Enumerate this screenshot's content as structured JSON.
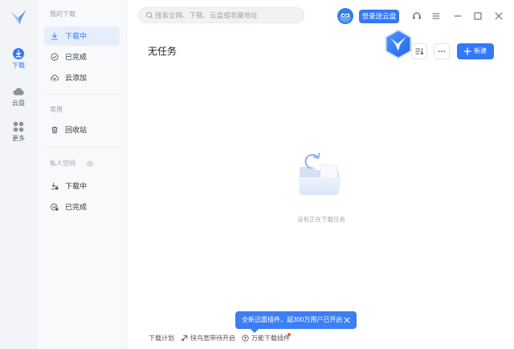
{
  "colors": {
    "primary": "#3478f6",
    "active_bg": "#e6eefd",
    "tooltip": "#3b7ef5",
    "badge": "#f25a45"
  },
  "rail": {
    "logo_icon": "thunder-bird-logo-icon",
    "items": [
      {
        "label": "下载",
        "icon": "download-circle-icon",
        "active": true
      },
      {
        "label": "云盘",
        "icon": "cloud-icon",
        "active": false
      },
      {
        "label": "更多",
        "icon": "grid-icon",
        "active": false
      }
    ]
  },
  "nav": {
    "sections": [
      {
        "title": "我的下载",
        "items": [
          {
            "label": "下载中",
            "icon": "download-icon",
            "active": true
          },
          {
            "label": "已完成",
            "icon": "check-circle-icon",
            "active": false
          },
          {
            "label": "云添加",
            "icon": "cloud-upload-icon",
            "active": false
          }
        ]
      },
      {
        "title": "常用",
        "items": [
          {
            "label": "回收站",
            "icon": "trash-icon",
            "active": false
          }
        ]
      },
      {
        "title": "私人空间",
        "title_icon": "eye-icon",
        "items": [
          {
            "label": "下载中",
            "icon": "private-download-icon",
            "active": false
          },
          {
            "label": "已完成",
            "icon": "private-check-icon",
            "active": false
          }
        ]
      }
    ]
  },
  "topbar": {
    "search_placeholder": "搜索全网、下载、云盘或收藏地址",
    "login_label": "登录送云盘",
    "icons": [
      "search-icon",
      "avatar",
      "headphone-icon",
      "menu-icon",
      "minimize-icon",
      "maximize-icon",
      "close-icon"
    ]
  },
  "main": {
    "title": "无任务",
    "new_label": "新建",
    "empty_text": "没有正在下载任务"
  },
  "tooltip": {
    "text": "全新迅雷插件，超300万用户已开启"
  },
  "footer": {
    "items": [
      {
        "label": "下载计划"
      },
      {
        "label": "快鸟宽带待开启",
        "icon": "speed-bird-icon"
      },
      {
        "label": "万能下载插件",
        "icon": "plugin-icon",
        "badge": true
      }
    ]
  }
}
